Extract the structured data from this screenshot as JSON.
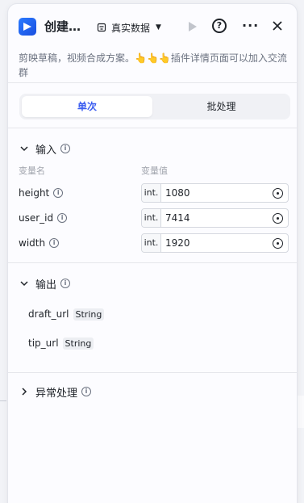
{
  "header": {
    "title": "创建…",
    "data_mode": "真实数据",
    "icons": [
      "app-icon",
      "database-icon",
      "play-icon",
      "help-icon",
      "more-icon",
      "close-icon"
    ]
  },
  "description": {
    "text": "剪映草稿，视频合成方案。",
    "hands": "👆👆👆",
    "text2": "插件详情页面可以加入交流群"
  },
  "tabs": [
    {
      "label": "单次",
      "active": true
    },
    {
      "label": "批处理",
      "active": false
    }
  ],
  "input": {
    "title": "输入",
    "col_name": "变量名",
    "col_value": "变量值",
    "vars": [
      {
        "name": "height",
        "type": "int.",
        "value": "1080"
      },
      {
        "name": "user_id",
        "type": "int.",
        "value": "7414"
      },
      {
        "name": "width",
        "type": "int.",
        "value": "1920"
      }
    ]
  },
  "output": {
    "title": "输出",
    "fields": [
      {
        "name": "draft_url",
        "type": "String"
      },
      {
        "name": "tip_url",
        "type": "String"
      }
    ]
  },
  "exception": {
    "title": "异常处理"
  },
  "colors": {
    "accent": "#3a5cf0",
    "app_icon": "#2b7bff"
  }
}
